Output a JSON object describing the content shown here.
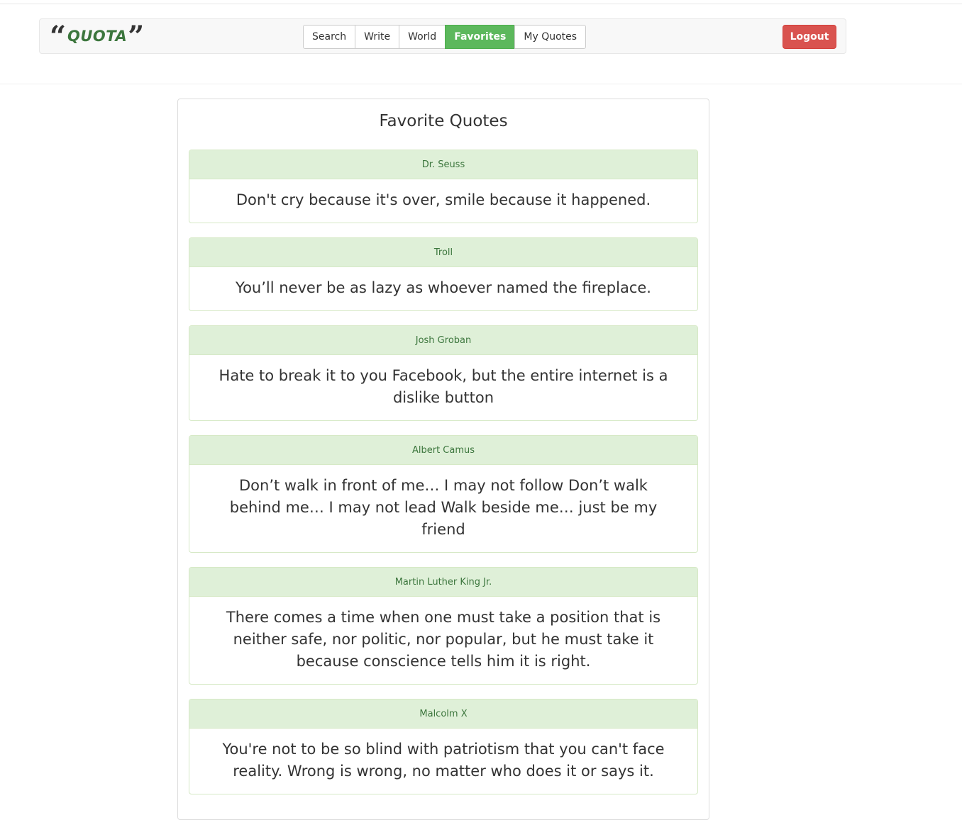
{
  "brand": {
    "open_quote": "“",
    "name": "QUOTA",
    "close_quote": "”"
  },
  "nav": {
    "items": [
      {
        "label": "Search",
        "active": false
      },
      {
        "label": "Write",
        "active": false
      },
      {
        "label": "World",
        "active": false
      },
      {
        "label": "Favorites",
        "active": true
      },
      {
        "label": "My Quotes",
        "active": false
      }
    ],
    "logout_label": "Logout"
  },
  "colors": {
    "accent_green": "#5cb85c",
    "logout_red": "#d9534f",
    "author_bg": "#dff0d8",
    "author_text": "#3c763d"
  },
  "main": {
    "title": "Favorite Quotes",
    "quotes": [
      {
        "author": "Dr. Seuss",
        "text": "Don't cry because it's over, smile because it happened."
      },
      {
        "author": "Troll",
        "text": "You’ll never be as lazy as whoever named the fireplace."
      },
      {
        "author": "Josh Groban",
        "text": "Hate to break it to you Facebook, but the entire internet is a dislike button"
      },
      {
        "author": "Albert Camus",
        "text": "Don’t walk in front of me… I may not follow Don’t walk behind me… I may not lead Walk beside me… just be my friend"
      },
      {
        "author": "Martin Luther King Jr.",
        "text": "There comes a time when one must take a position that is neither safe, nor politic, nor popular, but he must take it because conscience tells him it is right."
      },
      {
        "author": "Malcolm X",
        "text": "You're not to be so blind with patriotism that you can't face reality. Wrong is wrong, no matter who does it or says it."
      }
    ]
  }
}
